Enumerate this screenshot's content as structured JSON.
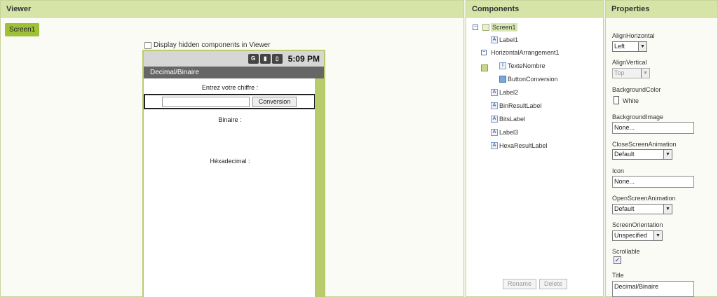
{
  "viewer": {
    "header": "Viewer",
    "screen_tab": "Screen1",
    "hidden_label": "Display hidden components in Viewer",
    "phone": {
      "time": "5:09 PM",
      "title": "Decimal/Binaire",
      "label1": "Entrez votre chiffre :",
      "button": "Conversion",
      "label2": "Binaire :",
      "label3": "Héxadecimal :"
    }
  },
  "components": {
    "header": "Components",
    "tree": {
      "screen": "Screen1",
      "label1": "Label1",
      "harr": "HorizontalArrangement1",
      "texte": "TexteNombre",
      "button": "ButtonConversion",
      "label2": "Label2",
      "bin": "BinResultLabel",
      "bits": "BitsLabel",
      "label3": "Label3",
      "hexa": "HexaResultLabel"
    },
    "rename": "Rename",
    "delete": "Delete"
  },
  "properties": {
    "header": "Properties",
    "align_h_label": "AlignHorizontal",
    "align_h_value": "Left",
    "align_v_label": "AlignVertical",
    "align_v_value": "Top",
    "bg_color_label": "BackgroundColor",
    "bg_color_value": "White",
    "bg_image_label": "BackgroundImage",
    "bg_image_value": "None...",
    "close_anim_label": "CloseScreenAnimation",
    "close_anim_value": "Default",
    "icon_label": "Icon",
    "icon_value": "None...",
    "open_anim_label": "OpenScreenAnimation",
    "open_anim_value": "Default",
    "orientation_label": "ScreenOrientation",
    "orientation_value": "Unspecified",
    "scrollable_label": "Scrollable",
    "title_label": "Title",
    "title_value": "Decimal/Binaire"
  }
}
